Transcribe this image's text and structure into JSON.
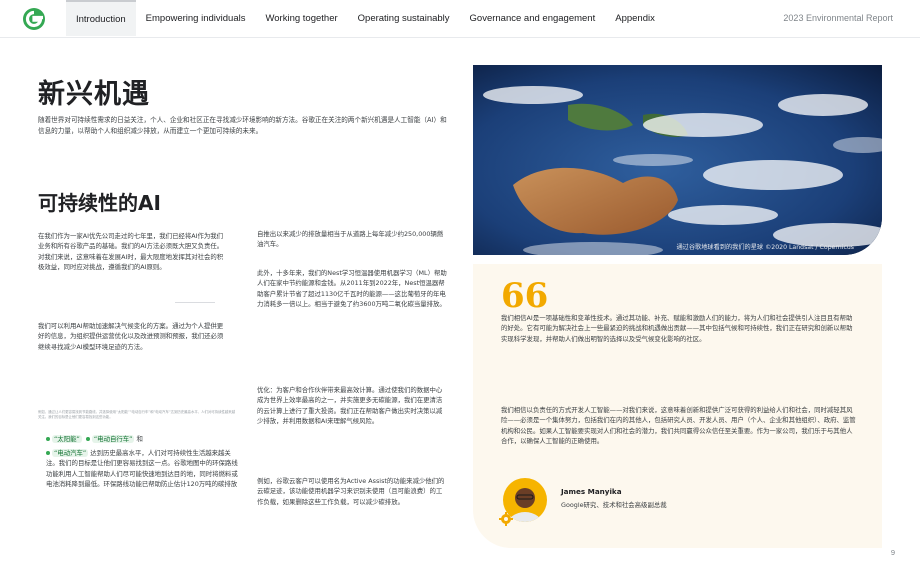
{
  "nav": {
    "tabs": [
      {
        "label": "Introduction",
        "active": true
      },
      {
        "label": "Empowering individuals",
        "active": false
      },
      {
        "label": "Working together",
        "active": false
      },
      {
        "label": "Operating sustainably",
        "active": false
      },
      {
        "label": "Governance and engagement",
        "active": false
      },
      {
        "label": "Appendix",
        "active": false
      }
    ],
    "report_title": "2023 Environmental Report"
  },
  "heading": "新兴机遇",
  "intro": "随着世界对可持续性需求的日益关注，个人、企业和社区正在寻找减少环境影响的新方法。谷歌正在关注的两个新兴机遇是人工智能（AI）和信息的力量，以帮助个人和组织减少排放，从而建立一个更加可持续的未来。",
  "section_title": "可持续性的AI",
  "col1": {
    "p1": "在我们作为一家AI优先公司走过的七年里，我们已经将AI作为我们业务和所有谷歌产品的基础。我们的AI方法必须既大胆又负责任。对我们来说，这意味着在发展AI时，最大限度地发挥其对社会的积极效益，同时应对挑战，遵循我们的AI原则。",
    "p2": "我们可以利用AI帮助加速解决气候变化的方案。通过为个人提供更好的信息，为组织提供运营优化以及改进预测和预报，我们还必须继续寻找减少AI模型环境足迹的方法。",
    "footnote": "例如，通过让人们更容易找到节能路线，并选择使用“太阳能”“电动自行车”和“电动汽车”达到历史最高水平，人们对可持续性越来越关注。我们的目标是让他们更容易找到这些功能。",
    "chip1": "“太阳能”",
    "chip2": "“电动自行车”",
    "chip_suffix": "和",
    "chip3": "“电动汽车”",
    "p3": "达到历史最高水平，人们对可持续性生活越来越关注。我们的目标是让他们更容易找到这一点。谷歌地图中的环保路线功能利用人工智能帮助人们尽可能快速地到达目的地，同时将燃料或电池消耗降到最低。环保路线功能已帮助防止估计120万吨的碳排放"
  },
  "col2": {
    "p1": "自推出以来减少的排放量相当于从道路上每年减少约250,000辆燃油汽车。",
    "p2": "此外，十多年来，我们的Nest学习恒温器使用机器学习（ML）帮助人们在家中节约能源和金钱。从2011年到2022年，Nest恒温器帮助客户累计节省了超过1130亿千瓦时的能源——这比葡萄牙的年电力消耗多一倍以上。相当于避免了约3600万吨二氧化碳当量排放。",
    "p3": "优化：为客户和合作伙伴带来最高效计算。通过使我们的数据中心成为世界上效率最高的之一，并实施更多无碳能源，我们在更清洁的云计算上进行了重大投资。我们正在帮助客户做出实时决策以减少排放，并利用数据和AI来理解气候风险。",
    "p4": "例如，谷歌云客户可以使用名为Active Assist的功能来减少他们的云碳足迹，该功能使用机器学习来识别未使用（且可能浪费）的工作负载，如果删除这些工作负载，可以减少碳排放。"
  },
  "photo": {
    "caption": "通过谷歌地球看到的我们的星球 ©2020 Landsat / Copernicus"
  },
  "quote": {
    "mark": "66",
    "p1": "我们相信AI是一项基础性和变革性技术。通过其功能、补充、赋能和激励人们的能力，将为人们和社会提供引人注目且有帮助的好处。它有可能为解决社会上一些最紧迫的挑战和机遇做出贡献——其中包括气候和可持续性，我们正在研究和创新以帮助实现科学发现，并帮助人们做出明智的选择以及受气候变化影响的社区。",
    "p2": "我们相信以负责任的方式开发人工智能——对我们来说，这意味着创新和提供广泛可获得的利益给人们和社会，同时减轻其风险——必须是一个集体努力，包括我们在内的其他人，包括研究人员、开发人员、用户（个人、企业和其他组织）、政府、监管机构和公民。如果人工智能要实现对人们和社会的潜力，我们共同赢得公众信任至关重要。作为一家公司，我们乐于与其他人合作，以确保人工智能的正确使用。",
    "person_name": "James Manyika",
    "person_role": "Google研究、技术和社会高级副总裁"
  },
  "page_number": "9",
  "colors": {
    "accent_yellow": "#f2a900",
    "chip_green_bg": "#e6f4ea",
    "card_bg": "#fdf8ee"
  }
}
